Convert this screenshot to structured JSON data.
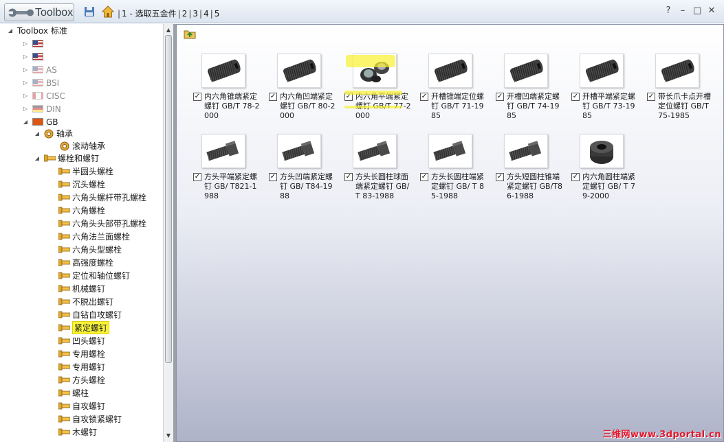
{
  "titlebar": {
    "app_name": "Toolbox",
    "breadcrumb_1": "1 - 选取五金件",
    "pages": [
      "2",
      "3",
      "4",
      "5"
    ],
    "help": "?",
    "minimize": "–",
    "maximize": "□",
    "close": "✕"
  },
  "tree": {
    "root": "Toolbox 标准",
    "standards": [
      "",
      "",
      "AS",
      "BSI",
      "CISC",
      "DIN",
      "GB"
    ],
    "gb_children": {
      "bearing": "轴承",
      "bearing_sub": "滚动轴承",
      "bolts_screws": "螺栓和螺钉",
      "items": [
        "半圆头螺栓",
        "沉头螺栓",
        "六角头螺杆带孔螺栓",
        "六角螺栓",
        "六角头头部带孔螺栓",
        "六角法兰面螺栓",
        "六角头型螺栓",
        "高强度螺栓",
        "定位和轴位螺钉",
        "机械螺钉",
        "不脱出螺钉",
        "自钻自攻螺钉",
        "紧定螺钉",
        "凹头螺钉",
        "专用螺栓",
        "专用螺钉",
        "方头螺栓",
        "螺柱",
        "自攻螺钉",
        "自攻锁紧螺钉",
        "木螺钉"
      ]
    }
  },
  "main": {
    "items": [
      {
        "caption": "内六角锥端紧定螺钉 GB/T 78-2000",
        "checked": true
      },
      {
        "caption": "内六角凹端紧定螺钉 GB/T 80-2000",
        "checked": true
      },
      {
        "caption": "内六角平端紧定螺钉 GB/T 77-2000",
        "checked": true
      },
      {
        "caption": "开槽锥端定位螺钉 GB/T 71-1985",
        "checked": true
      },
      {
        "caption": "开槽凹端紧定螺钉 GB/T 74-1985",
        "checked": true
      },
      {
        "caption": "开槽平端紧定螺钉 GB/T 73-1985",
        "checked": true
      },
      {
        "caption": "带长爪卡点开槽定位螺钉 GB/T 75-1985",
        "checked": true
      },
      {
        "caption": "方头平端紧定螺钉 GB/ T821-1988",
        "checked": true
      },
      {
        "caption": "方头凹端紧定螺钉 GB/ T84-1988",
        "checked": true
      },
      {
        "caption": "方头长圆柱球面端紧定螺钉 GB/T 83-1988",
        "checked": true
      },
      {
        "caption": "方头长圆柱端紧定螺钉 GB/ T 85-1988",
        "checked": true
      },
      {
        "caption": "方头短圆柱锥端紧定螺钉 GB/T86-1988",
        "checked": true
      },
      {
        "caption": "内六角圆柱端紧定螺钉 GB/ T 79-2000",
        "checked": true
      }
    ]
  },
  "watermark": "三维网www.3dportal.cn",
  "colors": {
    "highlight": "#f8f12f",
    "watermark": "#e3182c"
  }
}
